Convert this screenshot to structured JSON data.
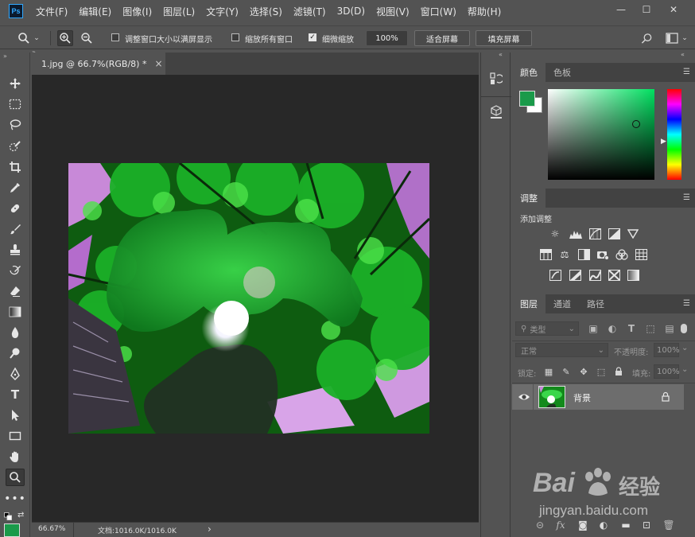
{
  "menu": [
    "文件(F)",
    "编辑(E)",
    "图像(I)",
    "图层(L)",
    "文字(Y)",
    "选择(S)",
    "滤镜(T)",
    "3D(D)",
    "视图(V)",
    "窗口(W)",
    "帮助(H)"
  ],
  "app_logo": "Ps",
  "window_controls": {
    "minimize": "—",
    "maximize": "☐",
    "close": "✕"
  },
  "options": {
    "resize_windows_label": "调整窗口大小以满屏显示",
    "zoom_all_label": "缩放所有窗口",
    "scrubby_zoom_label": "细微缩放",
    "zoom_value": "100%",
    "fit_screen": "适合屏幕",
    "fill_screen": "填充屏幕",
    "resize_windows_checked": false,
    "zoom_all_checked": false,
    "scrubby_checked": true
  },
  "document": {
    "tab_title": "1.jpg @ 66.7%(RGB/8) *",
    "close_glyph": "×"
  },
  "status": {
    "zoom": "66.67%",
    "doc_info": "文档:1016.0K/1016.0K",
    "arrow": "›"
  },
  "color_panel": {
    "tabs": [
      "颜色",
      "色板"
    ],
    "foreground": "#1a9a4a",
    "background": "#ffffff",
    "hue": "#00e060"
  },
  "adjust_panel": {
    "tab": "调整",
    "subtitle": "添加调整"
  },
  "layers_panel": {
    "tabs": [
      "图层",
      "通道",
      "路径"
    ],
    "filter_placeholder": "类型",
    "blend_mode": "正常",
    "opacity_label": "不透明度:",
    "opacity_value": "100%",
    "lock_label": "锁定:",
    "fill_label": "填充:",
    "fill_value": "100%",
    "layers": [
      {
        "name": "背景",
        "visible": true,
        "locked": true
      }
    ]
  },
  "watermark": {
    "brand_left": "Bai",
    "brand_right": "经验",
    "url": "jingyan.baidu.com"
  }
}
